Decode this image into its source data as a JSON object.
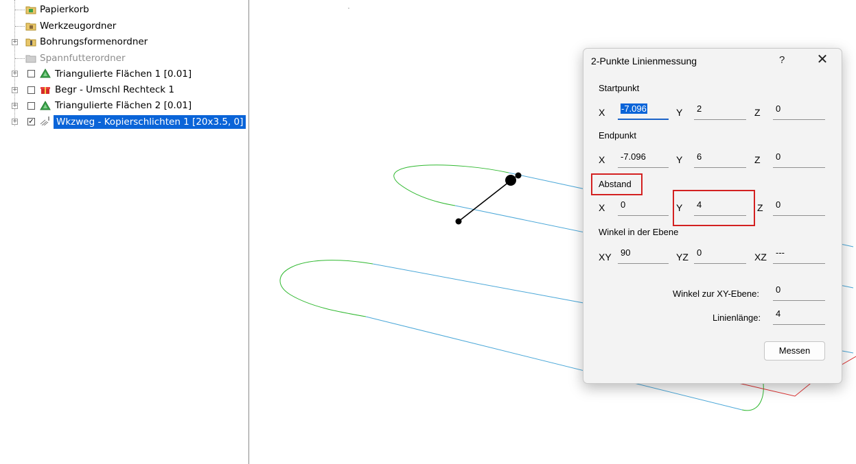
{
  "tree": {
    "items": [
      {
        "label": "Papierkorb",
        "icon": "recycle-bin-folder-icon"
      },
      {
        "label": "Werkzeugordner",
        "icon": "tool-folder-icon"
      },
      {
        "label": "Bohrungsformenordner",
        "icon": "hole-shape-folder-icon"
      },
      {
        "label": "Spannfutterordner",
        "icon": "chuck-folder-icon"
      },
      {
        "label": "Triangulierte Flächen 1 [0.01]",
        "icon": "triangle-surface-icon"
      },
      {
        "label": "Begr - Umschl Rechteck 1",
        "icon": "boundary-gift-icon"
      },
      {
        "label": "Triangulierte Flächen 2 [0.01]",
        "icon": "triangle-surface-icon"
      },
      {
        "label": "Wkzweg - Kopierschlichten 1 [20x3.5, 0]",
        "icon": "toolpath-icon"
      }
    ]
  },
  "dialog": {
    "title": "2-Punkte Linienmessung",
    "help": "?",
    "close": "✕",
    "startpunkt": {
      "label": "Startpunkt",
      "x_label": "X",
      "x": "-7.096",
      "y_label": "Y",
      "y": "2",
      "z_label": "Z",
      "z": "0"
    },
    "endpunkt": {
      "label": "Endpunkt",
      "x_label": "X",
      "x": "-7.096",
      "y_label": "Y",
      "y": "6",
      "z_label": "Z",
      "z": "0"
    },
    "abstand": {
      "label": "Abstand",
      "x_label": "X",
      "x": "0",
      "y_label": "Y",
      "y": "4",
      "z_label": "Z",
      "z": "0"
    },
    "winkel": {
      "label": "Winkel in der Ebene",
      "xy_label": "XY",
      "xy": "90",
      "yz_label": "YZ",
      "yz": "0",
      "xz_label": "XZ",
      "xz": "---"
    },
    "winkel_xy_label": "Winkel zur XY-Ebene:",
    "winkel_xy": "0",
    "laenge_label": "Linienlänge:",
    "laenge": "4",
    "measure_button": "Messen"
  },
  "colors": {
    "selection": "#0a64d8",
    "highlight_box": "#d32020",
    "path_green": "#2eb82e",
    "path_blue": "#4aa7d8",
    "path_red": "#e03030"
  }
}
